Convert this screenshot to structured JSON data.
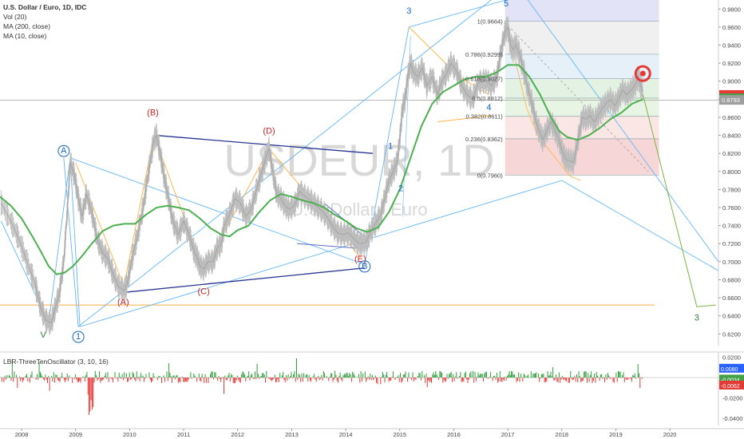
{
  "header": {
    "symbol_line": "U.S. Dollar / Euro, 1D, IDC",
    "indicators": [
      "Vol (20)",
      "MA (200, close)",
      "MA (10, close)"
    ]
  },
  "watermark": {
    "symbol": "USDEUR, 1D",
    "name": "U.S. Dollar / Euro"
  },
  "oscillator": {
    "label": "LBR-ThreeTenOscillator (3, 10, 16)"
  },
  "chart_data": {
    "type": "line",
    "title": "U.S. Dollar / Euro, 1D, IDC",
    "x_ticks": [
      "2008",
      "2009",
      "2010",
      "2011",
      "2012",
      "2013",
      "2014",
      "2015",
      "2016",
      "2017",
      "2018",
      "2019",
      "2020"
    ],
    "x_range": [
      2007.6,
      2020.9
    ],
    "ylim": [
      0.607,
      0.99
    ],
    "y_ticks": [
      "0.9800",
      "0.9600",
      "0.9400",
      "0.9200",
      "0.9000",
      "0.8800",
      "0.8600",
      "0.8400",
      "0.8200",
      "0.8000",
      "0.7800",
      "0.7600",
      "0.7400",
      "0.7200",
      "0.7000",
      "0.6800",
      "0.6600",
      "0.6400",
      "0.6200"
    ],
    "current_price": {
      "label": "0.8848",
      "value": 0.8848,
      "color": "#e53935"
    },
    "ma_labels": [
      {
        "label": "0.8811",
        "value": 0.8811,
        "color": "#43a047"
      },
      {
        "label": "0.8793",
        "value": 0.8793,
        "color": "#9e9e9e"
      }
    ],
    "price_series": {
      "name": "",
      "points": [
        [
          2007.62,
          0.765
        ],
        [
          2007.8,
          0.745
        ],
        [
          2007.95,
          0.725
        ],
        [
          2008.1,
          0.7
        ],
        [
          2008.25,
          0.675
        ],
        [
          2008.35,
          0.65
        ],
        [
          2008.45,
          0.635
        ],
        [
          2008.55,
          0.632
        ],
        [
          2008.62,
          0.648
        ],
        [
          2008.7,
          0.665
        ],
        [
          2008.78,
          0.7
        ],
        [
          2008.85,
          0.76
        ],
        [
          2008.9,
          0.81
        ],
        [
          2008.98,
          0.795
        ],
        [
          2009.05,
          0.77
        ],
        [
          2009.12,
          0.75
        ],
        [
          2009.2,
          0.775
        ],
        [
          2009.3,
          0.755
        ],
        [
          2009.4,
          0.725
        ],
        [
          2009.5,
          0.71
        ],
        [
          2009.6,
          0.703
        ],
        [
          2009.7,
          0.685
        ],
        [
          2009.8,
          0.672
        ],
        [
          2009.9,
          0.668
        ],
        [
          2009.95,
          0.675
        ],
        [
          2010.05,
          0.705
        ],
        [
          2010.15,
          0.73
        ],
        [
          2010.25,
          0.76
        ],
        [
          2010.35,
          0.8
        ],
        [
          2010.45,
          0.835
        ],
        [
          2010.5,
          0.84
        ],
        [
          2010.58,
          0.815
        ],
        [
          2010.65,
          0.79
        ],
        [
          2010.72,
          0.77
        ],
        [
          2010.8,
          0.745
        ],
        [
          2010.9,
          0.73
        ],
        [
          2011.0,
          0.745
        ],
        [
          2011.1,
          0.73
        ],
        [
          2011.2,
          0.71
        ],
        [
          2011.25,
          0.705
        ],
        [
          2011.3,
          0.695
        ],
        [
          2011.37,
          0.692
        ],
        [
          2011.45,
          0.7
        ],
        [
          2011.55,
          0.7
        ],
        [
          2011.62,
          0.715
        ],
        [
          2011.7,
          0.72
        ],
        [
          2011.75,
          0.74
        ],
        [
          2011.85,
          0.752
        ],
        [
          2011.95,
          0.77
        ],
        [
          2012.05,
          0.765
        ],
        [
          2012.15,
          0.75
        ],
        [
          2012.25,
          0.758
        ],
        [
          2012.35,
          0.78
        ],
        [
          2012.45,
          0.8
        ],
        [
          2012.52,
          0.815
        ],
        [
          2012.58,
          0.825
        ],
        [
          2012.65,
          0.8
        ],
        [
          2012.72,
          0.775
        ],
        [
          2012.8,
          0.77
        ],
        [
          2012.88,
          0.762
        ],
        [
          2012.95,
          0.758
        ],
        [
          2013.05,
          0.762
        ],
        [
          2013.15,
          0.778
        ],
        [
          2013.25,
          0.772
        ],
        [
          2013.35,
          0.768
        ],
        [
          2013.45,
          0.762
        ],
        [
          2013.55,
          0.757
        ],
        [
          2013.65,
          0.75
        ],
        [
          2013.75,
          0.74
        ],
        [
          2013.85,
          0.732
        ],
        [
          2013.95,
          0.73
        ],
        [
          2014.05,
          0.732
        ],
        [
          2014.15,
          0.725
        ],
        [
          2014.25,
          0.72
        ],
        [
          2014.3,
          0.72
        ],
        [
          2014.38,
          0.722
        ],
        [
          2014.45,
          0.732
        ],
        [
          2014.55,
          0.742
        ],
        [
          2014.65,
          0.752
        ],
        [
          2014.72,
          0.77
        ],
        [
          2014.8,
          0.79
        ],
        [
          2014.88,
          0.8
        ],
        [
          2014.95,
          0.81
        ],
        [
          2015.0,
          0.835
        ],
        [
          2015.05,
          0.87
        ],
        [
          2015.1,
          0.88
        ],
        [
          2015.15,
          0.905
        ],
        [
          2015.2,
          0.92
        ],
        [
          2015.25,
          0.91
        ],
        [
          2015.33,
          0.905
        ],
        [
          2015.42,
          0.915
        ],
        [
          2015.5,
          0.895
        ],
        [
          2015.6,
          0.905
        ],
        [
          2015.7,
          0.885
        ],
        [
          2015.78,
          0.9
        ],
        [
          2015.88,
          0.91
        ],
        [
          2015.95,
          0.92
        ],
        [
          2016.05,
          0.912
        ],
        [
          2016.15,
          0.895
        ],
        [
          2016.25,
          0.885
        ],
        [
          2016.35,
          0.88
        ],
        [
          2016.45,
          0.898
        ],
        [
          2016.55,
          0.9
        ],
        [
          2016.62,
          0.9
        ],
        [
          2016.7,
          0.895
        ],
        [
          2016.8,
          0.905
        ],
        [
          2016.88,
          0.935
        ],
        [
          2016.95,
          0.955
        ],
        [
          2017.0,
          0.96
        ],
        [
          2017.05,
          0.94
        ],
        [
          2017.1,
          0.935
        ],
        [
          2017.15,
          0.94
        ],
        [
          2017.22,
          0.93
        ],
        [
          2017.3,
          0.91
        ],
        [
          2017.38,
          0.89
        ],
        [
          2017.45,
          0.875
        ],
        [
          2017.52,
          0.855
        ],
        [
          2017.6,
          0.842
        ],
        [
          2017.65,
          0.835
        ],
        [
          2017.72,
          0.845
        ],
        [
          2017.8,
          0.855
        ],
        [
          2017.88,
          0.845
        ],
        [
          2017.95,
          0.835
        ],
        [
          2018.02,
          0.82
        ],
        [
          2018.08,
          0.813
        ],
        [
          2018.15,
          0.812
        ],
        [
          2018.22,
          0.81
        ],
        [
          2018.3,
          0.835
        ],
        [
          2018.38,
          0.86
        ],
        [
          2018.45,
          0.858
        ],
        [
          2018.52,
          0.862
        ],
        [
          2018.6,
          0.855
        ],
        [
          2018.68,
          0.863
        ],
        [
          2018.75,
          0.87
        ],
        [
          2018.82,
          0.875
        ],
        [
          2018.9,
          0.88
        ],
        [
          2018.98,
          0.873
        ],
        [
          2019.05,
          0.88
        ],
        [
          2019.12,
          0.89
        ],
        [
          2019.2,
          0.885
        ],
        [
          2019.28,
          0.89
        ],
        [
          2019.35,
          0.895
        ],
        [
          2019.42,
          0.905
        ],
        [
          2019.46,
          0.895
        ],
        [
          2019.5,
          0.888
        ]
      ]
    },
    "ma200_series": {
      "name": "MA (200, close)",
      "color": "#4caf50",
      "points": [
        [
          2007.6,
          0.772
        ],
        [
          2007.8,
          0.762
        ],
        [
          2008.0,
          0.748
        ],
        [
          2008.2,
          0.728
        ],
        [
          2008.35,
          0.712
        ],
        [
          2008.5,
          0.695
        ],
        [
          2008.65,
          0.686
        ],
        [
          2008.8,
          0.688
        ],
        [
          2008.95,
          0.695
        ],
        [
          2009.1,
          0.705
        ],
        [
          2009.3,
          0.72
        ],
        [
          2009.5,
          0.734
        ],
        [
          2009.7,
          0.74
        ],
        [
          2009.9,
          0.742
        ],
        [
          2010.1,
          0.742
        ],
        [
          2010.3,
          0.752
        ],
        [
          2010.5,
          0.76
        ],
        [
          2010.7,
          0.762
        ],
        [
          2010.9,
          0.76
        ],
        [
          2011.1,
          0.757
        ],
        [
          2011.3,
          0.748
        ],
        [
          2011.5,
          0.737
        ],
        [
          2011.7,
          0.73
        ],
        [
          2011.85,
          0.728
        ],
        [
          2012.0,
          0.735
        ],
        [
          2012.2,
          0.74
        ],
        [
          2012.4,
          0.755
        ],
        [
          2012.6,
          0.768
        ],
        [
          2012.8,
          0.775
        ],
        [
          2013.0,
          0.772
        ],
        [
          2013.2,
          0.768
        ],
        [
          2013.4,
          0.765
        ],
        [
          2013.6,
          0.76
        ],
        [
          2013.8,
          0.752
        ],
        [
          2014.0,
          0.745
        ],
        [
          2014.2,
          0.737
        ],
        [
          2014.4,
          0.733
        ],
        [
          2014.6,
          0.738
        ],
        [
          2014.8,
          0.755
        ],
        [
          2015.0,
          0.78
        ],
        [
          2015.2,
          0.815
        ],
        [
          2015.4,
          0.85
        ],
        [
          2015.6,
          0.875
        ],
        [
          2015.8,
          0.888
        ],
        [
          2016.0,
          0.895
        ],
        [
          2016.2,
          0.902
        ],
        [
          2016.4,
          0.905
        ],
        [
          2016.6,
          0.905
        ],
        [
          2016.8,
          0.91
        ],
        [
          2017.0,
          0.918
        ],
        [
          2017.2,
          0.918
        ],
        [
          2017.4,
          0.905
        ],
        [
          2017.6,
          0.885
        ],
        [
          2017.8,
          0.86
        ],
        [
          2017.95,
          0.845
        ],
        [
          2018.1,
          0.838
        ],
        [
          2018.3,
          0.835
        ],
        [
          2018.5,
          0.84
        ],
        [
          2018.7,
          0.848
        ],
        [
          2018.9,
          0.858
        ],
        [
          2019.1,
          0.865
        ],
        [
          2019.3,
          0.875
        ],
        [
          2019.5,
          0.88
        ]
      ]
    },
    "fib_levels": [
      {
        "label": "1(0.9664)",
        "value": 0.9664,
        "band": "#f0f0f0"
      },
      {
        "label": "0.786(0.9299)",
        "value": 0.9299,
        "band": "#e6f0f8"
      },
      {
        "label": "0.618(0.9027)",
        "value": 0.9027,
        "band": "#e4f2e4"
      },
      {
        "label": "0.5(0.8812)",
        "value": 0.8812,
        "band": "#e8f5e4"
      },
      {
        "label": "0.382(0.8611)",
        "value": 0.8611,
        "band": "#fbe6e6"
      },
      {
        "label": "0.236(0.8362)",
        "value": 0.8362,
        "band": "#fbe6e6"
      },
      {
        "label": "0(0.7960)",
        "value": 0.796,
        "band": null
      }
    ],
    "wave_labels": [
      {
        "label": "V",
        "x": 2008.4,
        "y": 0.616,
        "color": "#2e7d32",
        "circle": false
      },
      {
        "label": "A",
        "x": 2008.78,
        "y": 0.82,
        "color": "#1565c0",
        "circle": true
      },
      {
        "label": "1",
        "x": 2009.05,
        "y": 0.614,
        "color": "#1565c0",
        "circle": true
      },
      {
        "label": "(A)",
        "x": 2009.88,
        "y": 0.652,
        "color": "#c62828",
        "circle": false
      },
      {
        "label": "(B)",
        "x": 2010.43,
        "y": 0.862,
        "color": "#c62828",
        "circle": false
      },
      {
        "label": "(C)",
        "x": 2011.37,
        "y": 0.664,
        "color": "#c62828",
        "circle": false
      },
      {
        "label": "(D)",
        "x": 2012.58,
        "y": 0.842,
        "color": "#c62828",
        "circle": false
      },
      {
        "label": "(E)",
        "x": 2014.27,
        "y": 0.7,
        "color": "#c62828",
        "circle": false
      },
      {
        "label": "B",
        "x": 2014.35,
        "y": 0.692,
        "color": "#1565c0",
        "circle": true
      },
      {
        "label": "1",
        "x": 2014.83,
        "y": 0.825,
        "color": "#1565c0",
        "circle": false
      },
      {
        "label": "2",
        "x": 2015.02,
        "y": 0.778,
        "color": "#1565c0",
        "circle": false
      },
      {
        "label": "3",
        "x": 2015.17,
        "y": 0.975,
        "color": "#1565c0",
        "circle": false
      },
      {
        "label": "4",
        "x": 2016.65,
        "y": 0.868,
        "color": "#1565c0",
        "circle": false
      },
      {
        "label": "5",
        "x": 2016.97,
        "y": 0.983,
        "color": "#1565c0",
        "circle": false
      },
      {
        "label": "3",
        "x": 2020.5,
        "y": 0.635,
        "color": "#2e7d32",
        "circle": false
      }
    ],
    "oscillator": {
      "name": "LBR-ThreeTenOscillator (3, 10, 16)",
      "ylim": [
        -0.047,
        0.022
      ],
      "y_ticks": [
        "0.0200",
        "0.0000",
        "-0.0200",
        "-0.0400"
      ],
      "value_labels": [
        {
          "label": "0.0080",
          "value": 0.0075,
          "color": "#2962ff"
        },
        {
          "label": "-0.0034",
          "value": -0.0005,
          "color": "#43a047"
        },
        {
          "label": "-0.0062",
          "value": -0.0062,
          "color": "#e53935"
        }
      ]
    }
  }
}
